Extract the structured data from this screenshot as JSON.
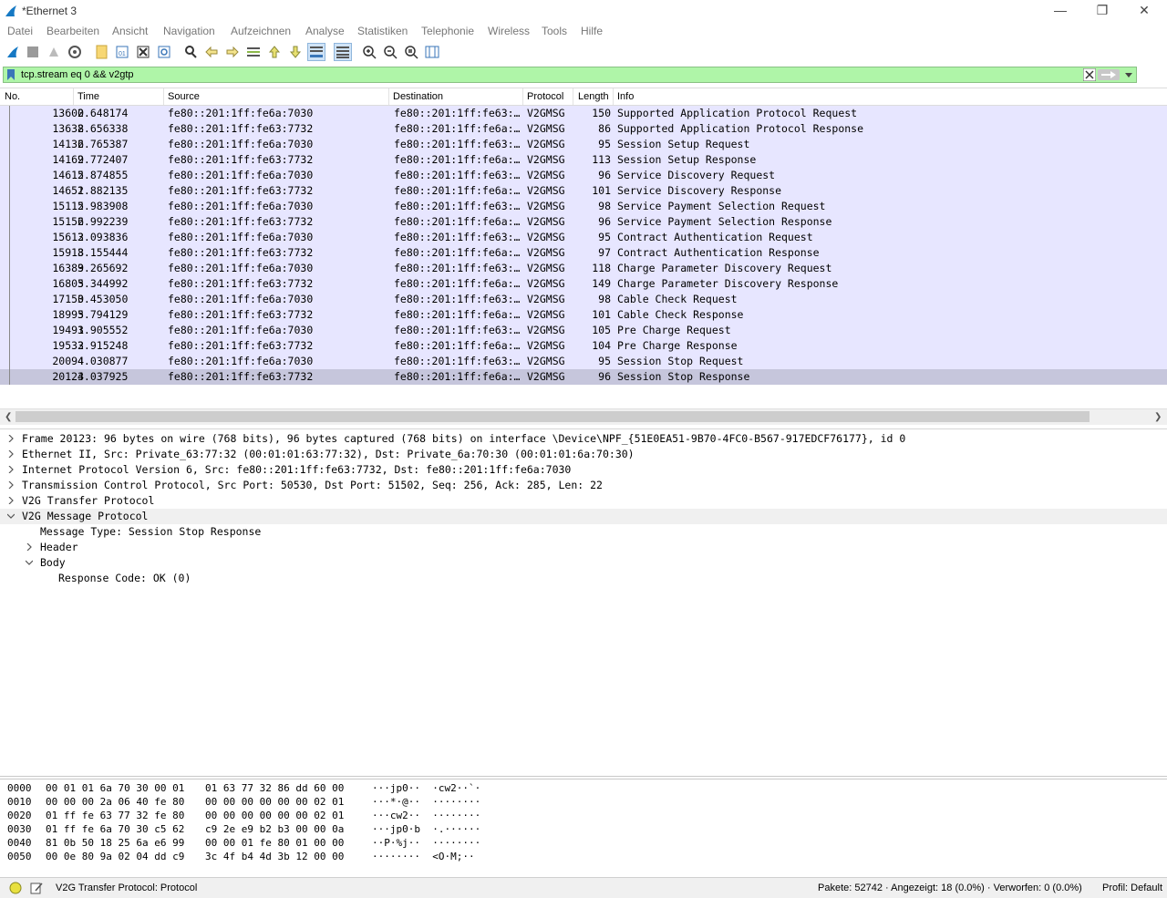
{
  "window": {
    "title": "*Ethernet 3"
  },
  "menu": [
    "Datei",
    "Bearbeiten",
    "Ansicht",
    "Navigation",
    "Aufzeichnen",
    "Analyse",
    "Statistiken",
    "Telephonie",
    "Wireless",
    "Tools",
    "Hilfe"
  ],
  "toolbar_icons": [
    "shark-fin-start-icon",
    "stop-icon",
    "restart-icon",
    "capture-options-icon",
    "open-file-icon",
    "save-file-icon",
    "close-file-icon",
    "reload-icon",
    "find-packet-icon",
    "go-back-icon",
    "go-forward-icon",
    "go-to-packet-icon",
    "first-packet-icon",
    "last-packet-icon",
    "autoscroll-icon",
    "colorize-icon",
    "zoom-in-icon",
    "zoom-out-icon",
    "normal-size-icon",
    "resize-columns-icon"
  ],
  "filter": {
    "text": "tcp.stream eq 0 && v2gtp",
    "bg_color": "#aff5a8"
  },
  "packet_list": {
    "columns": [
      "No.",
      "Time",
      "Source",
      "Destination",
      "Protocol",
      "Length",
      "Info"
    ],
    "rows": [
      {
        "no": "13600",
        "time": "2.648174",
        "src": "fe80::201:1ff:fe6a:7030",
        "dst": "fe80::201:1ff:fe63:…",
        "proto": "V2GMSG",
        "len": "150",
        "info": "Supported Application Protocol Request"
      },
      {
        "no": "13638",
        "time": "2.656338",
        "src": "fe80::201:1ff:fe63:7732",
        "dst": "fe80::201:1ff:fe6a:…",
        "proto": "V2GMSG",
        "len": "86",
        "info": "Supported Application Protocol Response"
      },
      {
        "no": "14136",
        "time": "2.765387",
        "src": "fe80::201:1ff:fe6a:7030",
        "dst": "fe80::201:1ff:fe63:…",
        "proto": "V2GMSG",
        "len": "95",
        "info": "Session Setup Request"
      },
      {
        "no": "14169",
        "time": "2.772407",
        "src": "fe80::201:1ff:fe63:7732",
        "dst": "fe80::201:1ff:fe6a:…",
        "proto": "V2GMSG",
        "len": "113",
        "info": "Session Setup Response"
      },
      {
        "no": "14615",
        "time": "2.874855",
        "src": "fe80::201:1ff:fe6a:7030",
        "dst": "fe80::201:1ff:fe63:…",
        "proto": "V2GMSG",
        "len": "96",
        "info": "Service Discovery Request"
      },
      {
        "no": "14651",
        "time": "2.882135",
        "src": "fe80::201:1ff:fe63:7732",
        "dst": "fe80::201:1ff:fe6a:…",
        "proto": "V2GMSG",
        "len": "101",
        "info": "Service Discovery Response"
      },
      {
        "no": "15115",
        "time": "2.983908",
        "src": "fe80::201:1ff:fe6a:7030",
        "dst": "fe80::201:1ff:fe63:…",
        "proto": "V2GMSG",
        "len": "98",
        "info": "Service Payment Selection Request"
      },
      {
        "no": "15156",
        "time": "2.992239",
        "src": "fe80::201:1ff:fe63:7732",
        "dst": "fe80::201:1ff:fe6a:…",
        "proto": "V2GMSG",
        "len": "96",
        "info": "Service Payment Selection Response"
      },
      {
        "no": "15612",
        "time": "3.093836",
        "src": "fe80::201:1ff:fe6a:7030",
        "dst": "fe80::201:1ff:fe63:…",
        "proto": "V2GMSG",
        "len": "95",
        "info": "Contract Authentication Request"
      },
      {
        "no": "15918",
        "time": "3.155444",
        "src": "fe80::201:1ff:fe63:7732",
        "dst": "fe80::201:1ff:fe6a:…",
        "proto": "V2GMSG",
        "len": "97",
        "info": "Contract Authentication Response"
      },
      {
        "no": "16389",
        "time": "3.265692",
        "src": "fe80::201:1ff:fe6a:7030",
        "dst": "fe80::201:1ff:fe63:…",
        "proto": "V2GMSG",
        "len": "118",
        "info": "Charge Parameter Discovery Request"
      },
      {
        "no": "16805",
        "time": "3.344992",
        "src": "fe80::201:1ff:fe63:7732",
        "dst": "fe80::201:1ff:fe6a:…",
        "proto": "V2GMSG",
        "len": "149",
        "info": "Charge Parameter Discovery Response"
      },
      {
        "no": "17150",
        "time": "3.453050",
        "src": "fe80::201:1ff:fe6a:7030",
        "dst": "fe80::201:1ff:fe63:…",
        "proto": "V2GMSG",
        "len": "98",
        "info": "Cable Check Request"
      },
      {
        "no": "18995",
        "time": "3.794129",
        "src": "fe80::201:1ff:fe63:7732",
        "dst": "fe80::201:1ff:fe6a:…",
        "proto": "V2GMSG",
        "len": "101",
        "info": "Cable Check Response"
      },
      {
        "no": "19491",
        "time": "3.905552",
        "src": "fe80::201:1ff:fe6a:7030",
        "dst": "fe80::201:1ff:fe63:…",
        "proto": "V2GMSG",
        "len": "105",
        "info": "Pre Charge Request"
      },
      {
        "no": "19532",
        "time": "3.915248",
        "src": "fe80::201:1ff:fe63:7732",
        "dst": "fe80::201:1ff:fe6a:…",
        "proto": "V2GMSG",
        "len": "104",
        "info": "Pre Charge Response"
      },
      {
        "no": "20094",
        "time": "4.030877",
        "src": "fe80::201:1ff:fe6a:7030",
        "dst": "fe80::201:1ff:fe63:…",
        "proto": "V2GMSG",
        "len": "95",
        "info": "Session Stop Request"
      },
      {
        "no": "20123",
        "time": "4.037925",
        "src": "fe80::201:1ff:fe63:7732",
        "dst": "fe80::201:1ff:fe6a:…",
        "proto": "V2GMSG",
        "len": "96",
        "info": "Session Stop Response",
        "selected": true
      }
    ],
    "row_color": "#e7e6ff",
    "selected_color": "#c6c6dc"
  },
  "details": [
    {
      "text": "Frame 20123: 96 bytes on wire (768 bits), 96 bytes captured (768 bits) on interface \\Device\\NPF_{51E0EA51-9B70-4FC0-B567-917EDCF76177}, id 0",
      "level": 0,
      "state": "collapsed"
    },
    {
      "text": "Ethernet II, Src: Private_63:77:32 (00:01:01:63:77:32), Dst: Private_6a:70:30 (00:01:01:6a:70:30)",
      "level": 0,
      "state": "collapsed"
    },
    {
      "text": "Internet Protocol Version 6, Src: fe80::201:1ff:fe63:7732, Dst: fe80::201:1ff:fe6a:7030",
      "level": 0,
      "state": "collapsed"
    },
    {
      "text": "Transmission Control Protocol, Src Port: 50530, Dst Port: 51502, Seq: 256, Ack: 285, Len: 22",
      "level": 0,
      "state": "collapsed"
    },
    {
      "text": "V2G Transfer Protocol",
      "level": 0,
      "state": "collapsed"
    },
    {
      "text": "V2G Message Protocol",
      "level": 0,
      "state": "expanded",
      "highlight": true
    },
    {
      "text": "Message Type: Session Stop Response",
      "level": 1,
      "state": "leaf"
    },
    {
      "text": "Header",
      "level": 1,
      "state": "collapsed"
    },
    {
      "text": "Body",
      "level": 1,
      "state": "expanded"
    },
    {
      "text": "Response Code: OK (0)",
      "level": 2,
      "state": "leaf"
    }
  ],
  "hex_dump": [
    {
      "offset": "0000",
      "bytes1": "00 01 01 6a 70 30 00 01",
      "bytes2": "01 63 77 32 86 dd 60 00",
      "ascii": "···jp0··  ·cw2··`·"
    },
    {
      "offset": "0010",
      "bytes1": "00 00 00 2a 06 40 fe 80",
      "bytes2": "00 00 00 00 00 00 02 01",
      "ascii": "···*·@··  ········"
    },
    {
      "offset": "0020",
      "bytes1": "01 ff fe 63 77 32 fe 80",
      "bytes2": "00 00 00 00 00 00 02 01",
      "ascii": "···cw2··  ········"
    },
    {
      "offset": "0030",
      "bytes1": "01 ff fe 6a 70 30 c5 62",
      "bytes2": "c9 2e e9 b2 b3 00 00 0a",
      "ascii": "···jp0·b  ·.······"
    },
    {
      "offset": "0040",
      "bytes1": "81 0b 50 18 25 6a e6 99",
      "bytes2": "00 00 01 fe 80 01 00 00",
      "ascii": "··P·%j··  ········"
    },
    {
      "offset": "0050",
      "bytes1": "00 0e 80 9a 02 04 dd c9",
      "bytes2": "3c 4f b4 4d 3b 12 00 00",
      "ascii": "········  <O·M;··"
    }
  ],
  "status": {
    "field": "V2G Transfer Protocol: Protocol",
    "counts": "Pakete: 52742 · Angezeigt: 18 (0.0%) · Verworfen: 0 (0.0%)",
    "profile": "Profil: Default"
  }
}
